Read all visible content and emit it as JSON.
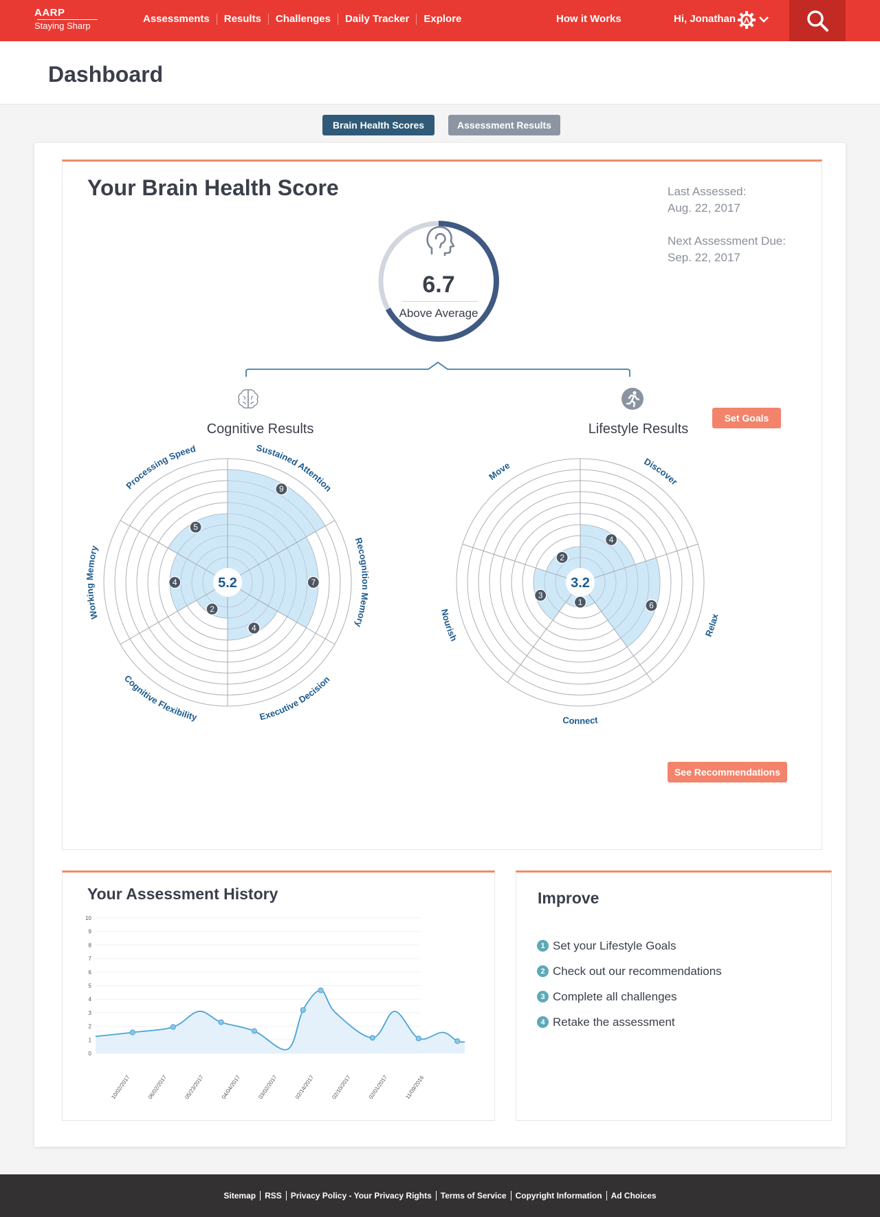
{
  "header": {
    "logo_brand": "AARP",
    "logo_sub": "Staying Sharp",
    "nav": [
      "Assessments",
      "Results",
      "Challenges",
      "Daily Tracker",
      "Explore"
    ],
    "how_it_works": "How it Works",
    "greeting": "Hi, Jonathan",
    "brand_color": "#e83a33"
  },
  "page": {
    "title": "Dashboard"
  },
  "tabs": [
    "Brain Health Scores",
    "Assessment Results"
  ],
  "score": {
    "title": "Your Brain Health Score",
    "value": "6.7",
    "value_fraction": 0.67,
    "label": "Above Average",
    "last_assessed_label": "Last Assessed:",
    "last_assessed": "Aug. 22, 2017",
    "next_due_label": "Next Assessment Due:",
    "next_due": "Sep. 22, 2017"
  },
  "cognitive": {
    "title": "Cognitive Results",
    "center": "5.2",
    "axes": [
      {
        "label": "Sustained Attention",
        "value": 9
      },
      {
        "label": "Recognition Memory",
        "value": 7
      },
      {
        "label": "Executive Decision",
        "value": 4
      },
      {
        "label": "Cognitive Flexibility",
        "value": 2
      },
      {
        "label": "Working Memory",
        "value": 4
      },
      {
        "label": "Processing Speed",
        "value": 5
      }
    ]
  },
  "lifestyle": {
    "title": "Lifestyle Results",
    "center": "3.2",
    "set_goals": "Set Goals",
    "see_recommendations": "See Recommendations",
    "axes": [
      {
        "label": "Discover",
        "value": 4
      },
      {
        "label": "Relax",
        "value": 6
      },
      {
        "label": "Connect",
        "value": 1
      },
      {
        "label": "Nourish",
        "value": 3
      },
      {
        "label": "Move",
        "value": 2
      }
    ]
  },
  "history": {
    "title": "Your Assessment History",
    "chart_data": {
      "type": "area",
      "x": [
        "11/09/2016",
        "02/01/2017",
        "02/10/2017",
        "02/14/2017",
        "03/02/2017",
        "04/04/2017",
        "05/23/2017",
        "06/02/2017",
        "10/02/2017"
      ],
      "ylim": [
        0,
        10
      ],
      "yticks": [
        "0",
        "1",
        "2",
        "3",
        "4",
        "5",
        "6",
        "7",
        "8",
        "9",
        "10"
      ],
      "points": [
        {
          "x": 0.0,
          "y": 1.25
        },
        {
          "x": 0.1,
          "y": 1.55
        },
        {
          "x": 0.21,
          "y": 1.95
        },
        {
          "x": 0.28,
          "y": 3.1
        },
        {
          "x": 0.34,
          "y": 2.3
        },
        {
          "x": 0.43,
          "y": 1.65
        },
        {
          "x": 0.52,
          "y": 0.3
        },
        {
          "x": 0.562,
          "y": 3.2
        },
        {
          "x": 0.61,
          "y": 4.65
        },
        {
          "x": 0.65,
          "y": 3.0
        },
        {
          "x": 0.75,
          "y": 1.15
        },
        {
          "x": 0.81,
          "y": 3.1
        },
        {
          "x": 0.875,
          "y": 1.1
        },
        {
          "x": 0.94,
          "y": 1.55
        },
        {
          "x": 0.98,
          "y": 0.9
        },
        {
          "x": 1.0,
          "y": 0.85
        }
      ],
      "marker_indices": [
        1,
        2,
        4,
        5,
        7,
        8,
        10,
        12,
        14
      ],
      "line_color": "#4aa3d6",
      "fill_color": "#e4f1fa"
    }
  },
  "improve": {
    "title": "Improve",
    "items": [
      "Set your Lifestyle Goals",
      "Check out our recommendations",
      "Complete all challenges",
      "Retake the assessment"
    ]
  },
  "footer": {
    "links": [
      "Sitemap",
      "RSS",
      "Privacy Policy - Your Privacy Rights",
      "Terms of Service",
      "Copyright Information",
      "Ad Choices"
    ]
  },
  "colors": {
    "accent_orange": "#f3836a",
    "navy": "#3f5983",
    "radar_fill": "#c5e4f7",
    "radar_label": "#1b5a8e"
  }
}
